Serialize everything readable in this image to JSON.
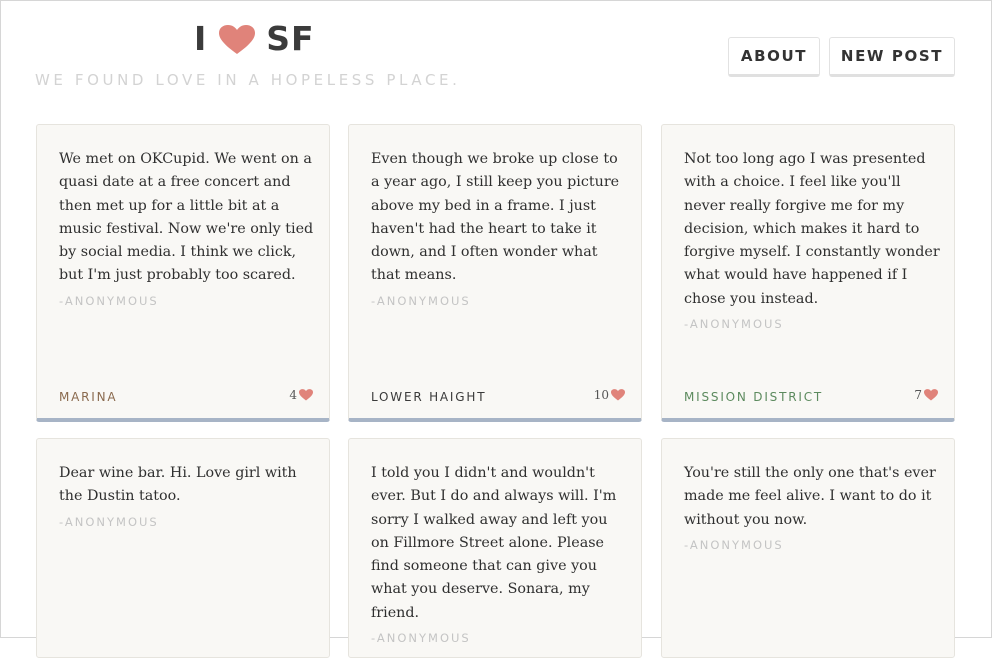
{
  "header": {
    "logo_left": "I",
    "logo_right": "SF",
    "tagline": "WE FOUND LOVE IN A HOPELESS PLACE.",
    "nav": {
      "about": "ABOUT",
      "new_post": "NEW POST"
    }
  },
  "colors": {
    "heart": "#e0837a",
    "marina": "#8a6a4e",
    "lower_haight": "#3a3a3a",
    "mission": "#5c8a5e"
  },
  "posts": [
    {
      "text": "We met on OKCupid.  We went on a quasi date at a free concert and then met up for a little bit at a music festival.  Now we're only tied by social media.  I think we click,  but I'm just probably too scared.",
      "author": "-ANONYMOUS",
      "neighborhood": "MARINA",
      "likes": "4"
    },
    {
      "text": "Even though we broke up close to a year ago, I still keep you picture above my bed in a frame.  I just haven't had the heart to take it down,  and I often wonder what that means.",
      "author": "-ANONYMOUS",
      "neighborhood": "LOWER HAIGHT",
      "likes": "10"
    },
    {
      "text": "Not too long ago I was presented with a choice.  I feel like you'll never really forgive me for my decision, which makes it hard to forgive myself.  I constantly wonder what would have happened if I chose you instead.",
      "author": "-ANONYMOUS",
      "neighborhood": "MISSION DISTRICT",
      "likes": "7"
    },
    {
      "text": "Dear wine bar.  Hi.  Love girl with the Dustin tatoo.",
      "author": "-ANONYMOUS"
    },
    {
      "text": "I told you I didn't and wouldn't ever.  But I do and always will.  I'm sorry I walked away and left you on Fillmore Street alone.  Please find someone that can give you what you deserve.  Sonara,  my friend.",
      "author": "-ANONYMOUS"
    },
    {
      "text": "You're still the only one that's ever made me feel alive.  I want to do it without you now.",
      "author": "-ANONYMOUS"
    }
  ]
}
